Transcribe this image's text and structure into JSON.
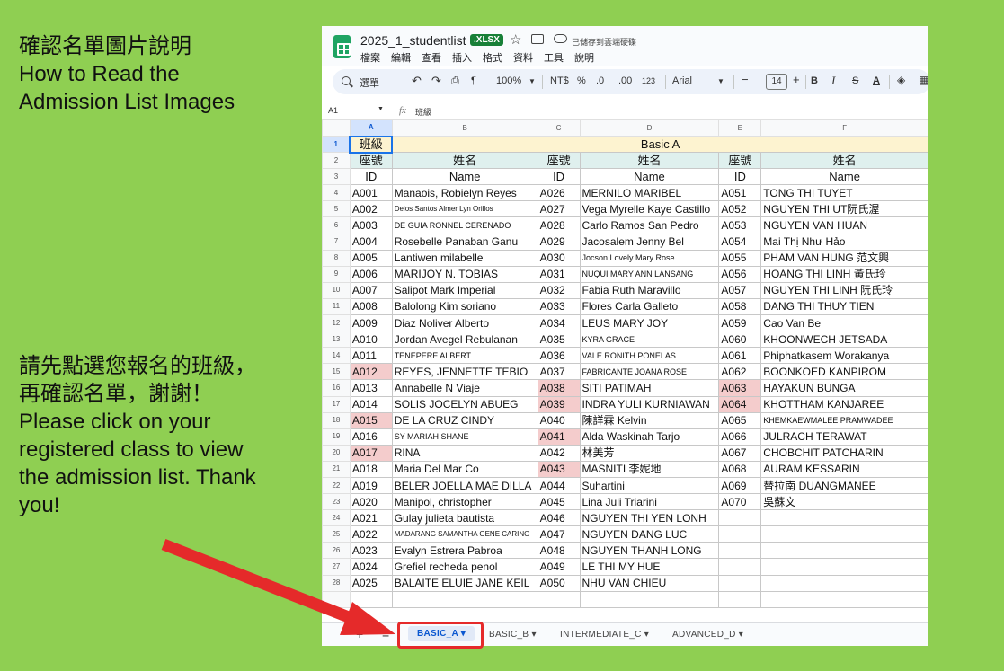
{
  "left_title_zh": "確認名單圖片說明",
  "left_title_en_1": "How to Read the",
  "left_title_en_2": "Admission List Images",
  "instr_zh_1": "請先點選您報名的班級，",
  "instr_zh_2": "再確認名單，謝謝！",
  "instr_en": [
    "Please click on your",
    "registered class to view",
    "the admission list. Thank",
    "you!"
  ],
  "doc": {
    "title": "2025_1_studentlist",
    "badge": ".XLSX",
    "saved": "已儲存到雲端硬碟",
    "menu": [
      "檔案",
      "編輯",
      "查看",
      "插入",
      "格式",
      "資料",
      "工具",
      "說明"
    ]
  },
  "toolbar": {
    "menus": "選單",
    "zoom": "100%",
    "currency": "NT$",
    "percent": "%",
    "dec_dec": ".0",
    "dec_inc": ".00",
    "format_123": "123",
    "font": "Arial",
    "font_size": "14",
    "minus": "−",
    "plus": "+",
    "bold": "B",
    "italic": "I",
    "strike": "S",
    "text_color": "A"
  },
  "formula": {
    "cell_ref": "A1",
    "fx": "fx",
    "value": "班級"
  },
  "columns": [
    "A",
    "B",
    "C",
    "D",
    "E",
    "F"
  ],
  "header": {
    "class_label": "班級",
    "class_name": "Basic A",
    "seat_zh": "座號",
    "name_zh": "姓名",
    "id_en": "ID",
    "name_en": "Name"
  },
  "rows": [
    [
      "A001",
      "Manaois, Robielyn Reyes",
      "A026",
      "MERNILO MARIBEL",
      "A051",
      "TONG THI TUYET"
    ],
    [
      "A002",
      "Delos Santos Almer Lyn Orillos",
      "A027",
      "Vega Myrelle Kaye Castillo",
      "A052",
      "NGUYEN THI UT阮氏渥"
    ],
    [
      "A003",
      "DE GUIA RONNEL CERENADO",
      "A028",
      "Carlo Ramos San Pedro",
      "A053",
      "NGUYEN VAN HUAN"
    ],
    [
      "A004",
      "Rosebelle Panaban Ganu",
      "A029",
      "Jacosalem Jenny Bel",
      "A054",
      "Mai Thị Như Hảo"
    ],
    [
      "A005",
      "Lantiwen milabelle",
      "A030",
      "Jocson Lovely Mary Rose",
      "A055",
      "PHAM VAN HUNG 范文興"
    ],
    [
      "A006",
      "MARIJOY N. TOBIAS",
      "A031",
      "NUQUI MARY ANN LANSANG",
      "A056",
      "HOANG THI LINH 黃氏玲"
    ],
    [
      "A007",
      "Salipot Mark Imperial",
      "A032",
      "Fabia Ruth Maravillo",
      "A057",
      "NGUYEN THI LINH 阮氏玲"
    ],
    [
      "A008",
      "Balolong Kim soriano",
      "A033",
      "Flores Carla Galleto",
      "A058",
      "DANG THI THUY TIEN"
    ],
    [
      "A009",
      "Diaz Noliver Alberto",
      "A034",
      "LEUS MARY JOY",
      "A059",
      "Cao Van Be"
    ],
    [
      "A010",
      "Jordan Avegel Rebulanan",
      "A035",
      "KYRA GRACE",
      "A060",
      "KHOONWECH JETSADA"
    ],
    [
      "A011",
      "TENEPERE ALBERT",
      "A036",
      "VALE RONITH PONELAS",
      "A061",
      "Phiphatkasem Worakanya"
    ],
    [
      "A012",
      "REYES, JENNETTE TEBIO",
      "A037",
      "FABRICANTE JOANA ROSE",
      "A062",
      "BOONKOED KANPIROM"
    ],
    [
      "A013",
      "Annabelle N Viaje",
      "A038",
      "SITI PATIMAH",
      "A063",
      "HAYAKUN BUNGA"
    ],
    [
      "A014",
      "SOLIS JOCELYN ABUEG",
      "A039",
      "INDRA YULI KURNIAWAN",
      "A064",
      "KHOTTHAM KANJAREE"
    ],
    [
      "A015",
      "DE LA CRUZ CINDY",
      "A040",
      "陳詳霖 Kelvin",
      "A065",
      "KHEMKAEWMALEE PRAMWADEE"
    ],
    [
      "A016",
      "SY MARIAH SHANE",
      "A041",
      "Alda Waskinah Tarjo",
      "A066",
      "JULRACH TERAWAT"
    ],
    [
      "A017",
      "RINA",
      "A042",
      "林美芳",
      "A067",
      "CHOBCHIT PATCHARIN"
    ],
    [
      "A018",
      "Maria Del Mar Co",
      "A043",
      "MASNITI 李妮地",
      "A068",
      "AURAM KESSARIN"
    ],
    [
      "A019",
      "BELER JOELLA MAE DILLA",
      "A044",
      "Suhartini",
      "A069",
      "替拉南 DUANGMANEE"
    ],
    [
      "A020",
      "Manipol, christopher",
      "A045",
      "Lina Juli Triarini",
      "A070",
      "吳蘇文"
    ],
    [
      "A021",
      "Gulay julieta bautista",
      "A046",
      "NGUYEN THI YEN LONH",
      "",
      ""
    ],
    [
      "A022",
      "MADARANG SAMANTHA GENE CARINO",
      "A047",
      "NGUYEN DANG LUC",
      "",
      ""
    ],
    [
      "A023",
      "Evalyn Estrera Pabroa",
      "A048",
      "NGUYEN THANH LONG",
      "",
      ""
    ],
    [
      "A024",
      "Grefiel recheda penol",
      "A049",
      "LE THI MY HUE",
      "",
      ""
    ],
    [
      "A025",
      "BALAITE ELUIE JANE KEIL",
      "A050",
      "NHU VAN CHIEU",
      "",
      ""
    ]
  ],
  "tabs": {
    "add": "+",
    "all_sheets": "≡",
    "basic_a": "BASIC_A",
    "basic_b": "BASIC_B",
    "intermediate_c": "INTERMEDIATE_C",
    "advanced_d": "ADVANCED_D",
    "caret": "▾"
  },
  "colors": {
    "background": "#8fcf52",
    "accent_red": "#e52a2a",
    "highlight_pink": "#f4cccc",
    "header_yellow": "#fdf3d0",
    "header_teal": "#dff0ee"
  }
}
